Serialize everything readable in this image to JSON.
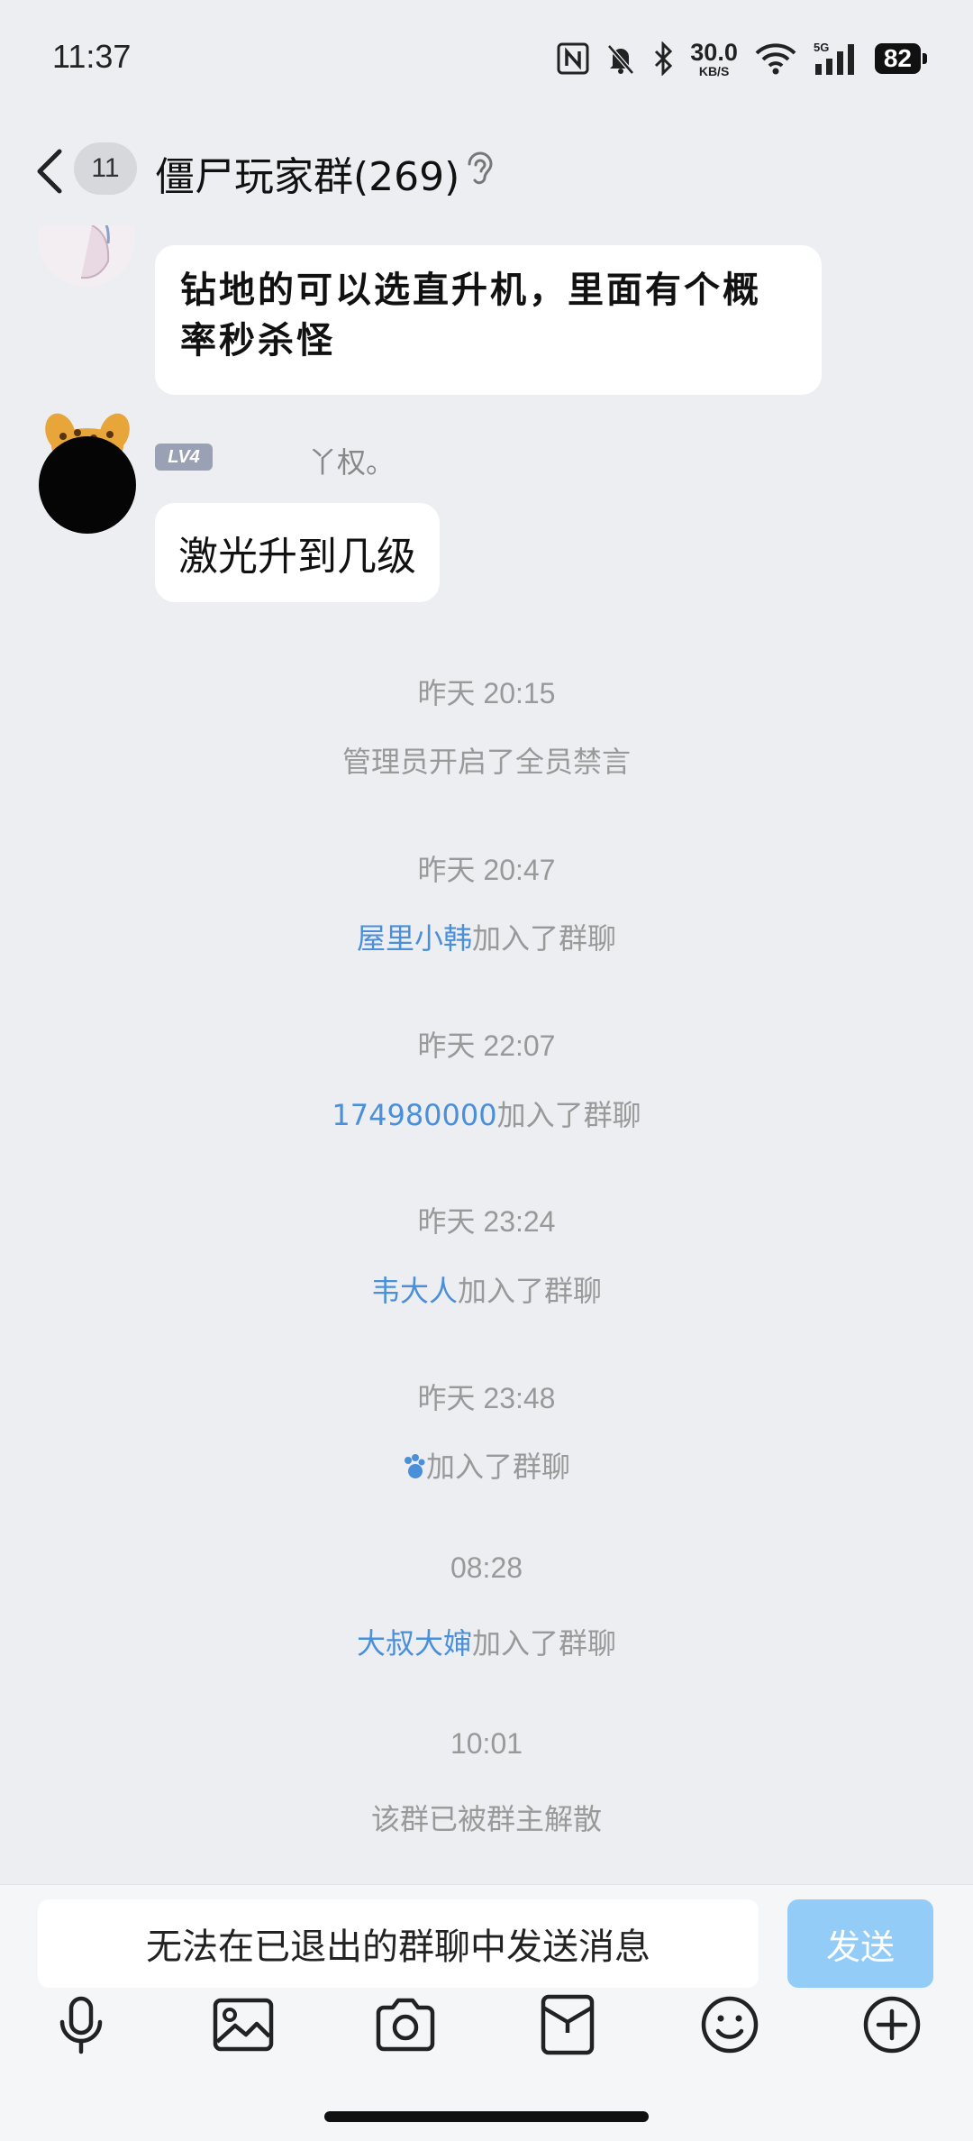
{
  "status_bar": {
    "time": "11:37",
    "net_speed_value": "30.0",
    "net_speed_unit": "KB/S",
    "network": "5G",
    "battery": "82"
  },
  "header": {
    "unread_count": "11",
    "title": "僵尸玩家群(269)"
  },
  "messages": [
    {
      "text": "钻地的可以选直升机，里面有个概率秒杀怪"
    },
    {
      "level": "LV4",
      "sender": "丫权。",
      "text": "激光升到几级"
    }
  ],
  "system_events": [
    {
      "time": "昨天 20:15",
      "name": "",
      "text": "管理员开启了全员禁言"
    },
    {
      "time": "昨天 20:47",
      "name": "屋里小韩",
      "text": "加入了群聊"
    },
    {
      "time": "昨天 22:07",
      "name": "174980000",
      "text": "加入了群聊"
    },
    {
      "time": "昨天 23:24",
      "name": "韦大人",
      "text": "加入了群聊"
    },
    {
      "time": "昨天 23:48",
      "name": "",
      "text": "加入了群聊"
    },
    {
      "time": "08:28",
      "name": "大叔大婶",
      "text": "加入了群聊"
    },
    {
      "time": "10:01",
      "name": "",
      "text": "该群已被群主解散"
    }
  ],
  "input": {
    "placeholder": "无法在已退出的群聊中发送消息",
    "send_label": "发送"
  },
  "toolbar": [
    "microphone-icon",
    "image-icon",
    "camera-icon",
    "red-packet-icon",
    "emoji-icon",
    "plus-icon"
  ],
  "colors": {
    "background": "#edeef2",
    "link": "#4a8fd9",
    "send_button": "#93cdf7"
  }
}
